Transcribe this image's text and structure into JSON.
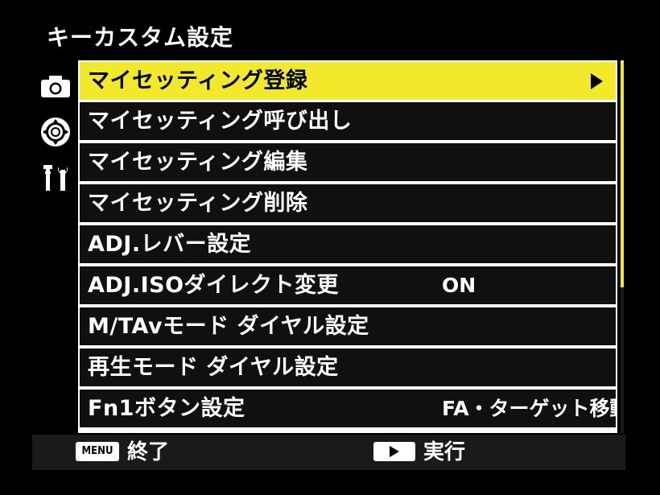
{
  "screen": {
    "title": "キーカスタム設定"
  },
  "tabs": [
    {
      "icon": "camera-icon",
      "active": false
    },
    {
      "icon": "dial-dpad-icon",
      "active": true
    },
    {
      "icon": "wrench-icon",
      "active": false
    }
  ],
  "menu": {
    "items": [
      {
        "label": "マイセッティング登録",
        "value": "",
        "selected": true,
        "has_submenu": true
      },
      {
        "label": "マイセッティング呼び出し",
        "value": ""
      },
      {
        "label": "マイセッティング編集",
        "value": ""
      },
      {
        "label": "マイセッティング削除",
        "value": ""
      },
      {
        "label": "ADJ.レバー設定",
        "value": ""
      },
      {
        "label": "ADJ.ISOダイレクト変更",
        "value": "ON"
      },
      {
        "label": "M/TAvモード ダイヤル設定",
        "value": ""
      },
      {
        "label": "再生モード ダイヤル設定",
        "value": ""
      },
      {
        "label": "Fn1ボタン設定",
        "value": "FA・ターゲット移動"
      }
    ]
  },
  "footer": {
    "menu_key": "MENU",
    "menu_action": "終了",
    "play_action": "実行"
  },
  "colors": {
    "highlight": "#f2e92c",
    "background": "#000000",
    "row": "#101010",
    "divider": "#ffffff"
  }
}
